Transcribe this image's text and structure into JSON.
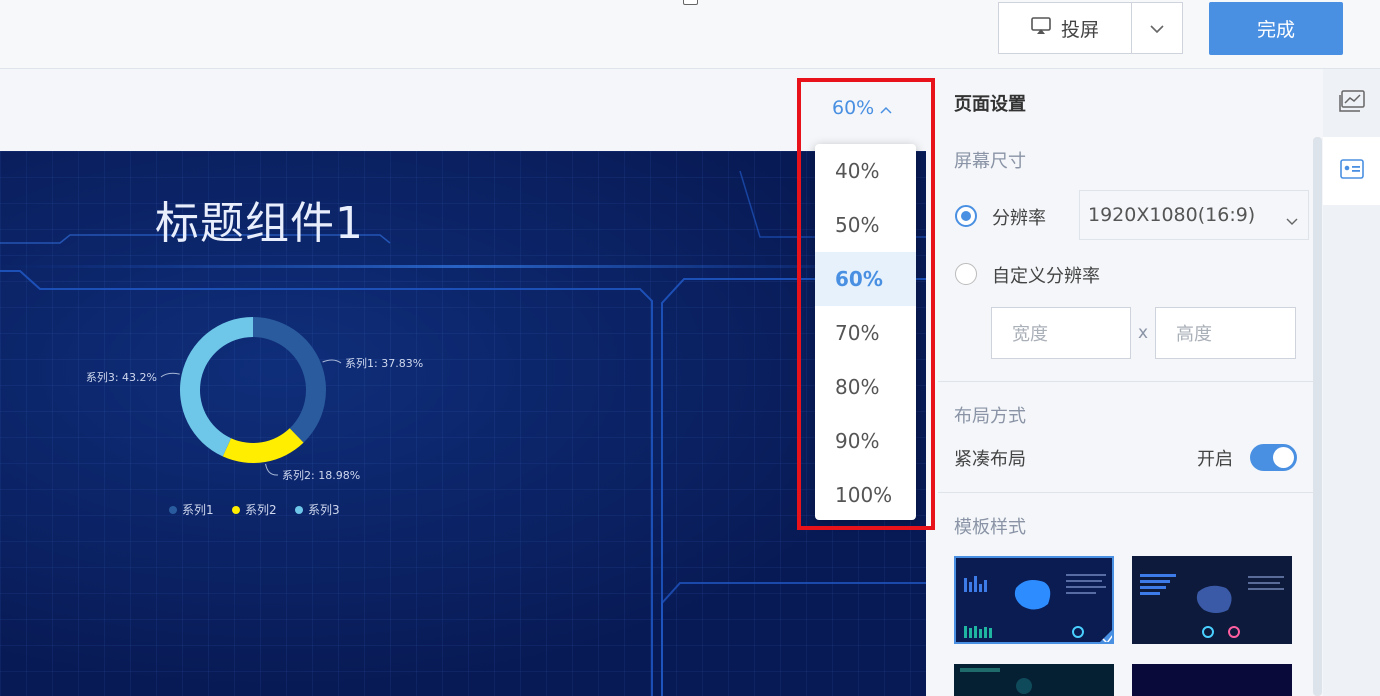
{
  "toolbar": {
    "cast_label": "投屏",
    "done_label": "完成"
  },
  "zoom": {
    "current": "60%",
    "options": [
      "40%",
      "50%",
      "60%",
      "70%",
      "80%",
      "90%",
      "100%"
    ],
    "selected_index": 2
  },
  "dashboard": {
    "title": "标题组件1"
  },
  "chart_data": {
    "type": "pie",
    "series": [
      {
        "name": "系列1",
        "value": 37.83,
        "label": "系列1: 37.83%",
        "color": "#2a5b9e"
      },
      {
        "name": "系列2",
        "value": 18.98,
        "label": "系列2: 18.98%",
        "color": "#ffee00"
      },
      {
        "name": "系列3",
        "value": 43.2,
        "label": "系列3: 43.2%",
        "color": "#6ec6e8"
      }
    ],
    "legend": "bottom"
  },
  "panel": {
    "title": "页面设置",
    "screen_size": {
      "title": "屏幕尺寸",
      "resolution_label": "分辨率",
      "resolution_value": "1920X1080(16:9)",
      "custom_label": "自定义分辨率",
      "width_placeholder": "宽度",
      "height_placeholder": "高度",
      "separator": "x"
    },
    "layout": {
      "title": "布局方式",
      "compact_label": "紧凑布局",
      "toggle_label": "开启",
      "toggle_on": true
    },
    "template": {
      "title": "模板样式"
    }
  },
  "colors": {
    "accent": "#4a90e2",
    "highlight": "#e8121b",
    "dashboard_bg": "#081a55"
  }
}
